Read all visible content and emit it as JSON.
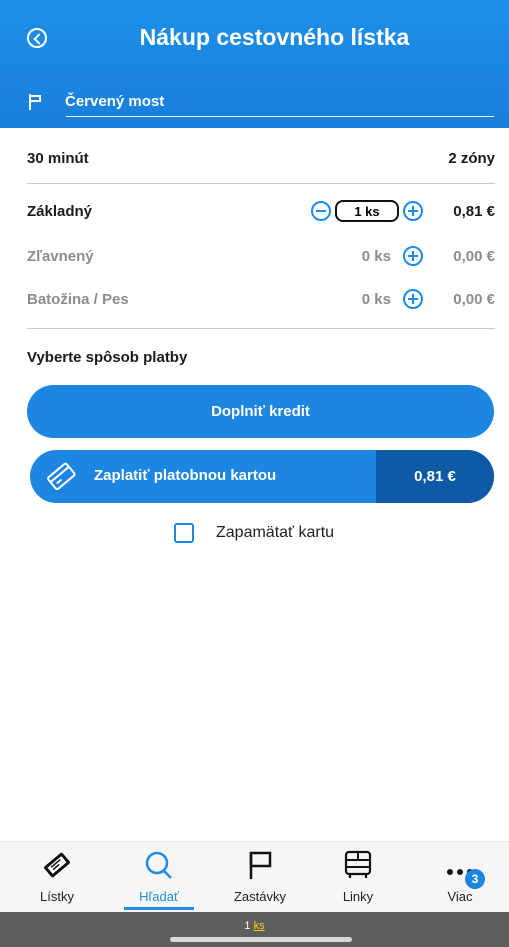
{
  "header": {
    "title": "Nákup cestovného lístka",
    "stop": "Červený most"
  },
  "ticket": {
    "duration": "30 minút",
    "zones": "2 zóny"
  },
  "rows": [
    {
      "label": "Základný",
      "qty": "1 ks",
      "price": "0,81 €"
    },
    {
      "label": "Zľavnený",
      "qty": "0 ks",
      "price": "0,00 €"
    },
    {
      "label": "Batožina / Pes",
      "qty": "0 ks",
      "price": "0,00 €"
    }
  ],
  "payment": {
    "heading": "Vyberte spôsob platby",
    "credit_label": "Doplniť kredit",
    "card_label": "Zaplatiť platobnou kartou",
    "card_price": "0,81 €",
    "remember_label": "Zapamätať kartu",
    "remember_checked": false
  },
  "tabs": [
    {
      "label": "Lístky",
      "icon": "ticket-icon"
    },
    {
      "label": "Hľadať",
      "icon": "search-icon",
      "active": true
    },
    {
      "label": "Zastávky",
      "icon": "flag-icon"
    },
    {
      "label": "Linky",
      "icon": "bus-icon"
    },
    {
      "label": "Viac",
      "icon": "more-icon",
      "badge": "3"
    }
  ],
  "bottom": {
    "count": "1",
    "unit": "ks"
  },
  "colors": {
    "primary": "#1c86e0",
    "dark_accent": "#0f5aa6",
    "header": "#1e90e8"
  }
}
